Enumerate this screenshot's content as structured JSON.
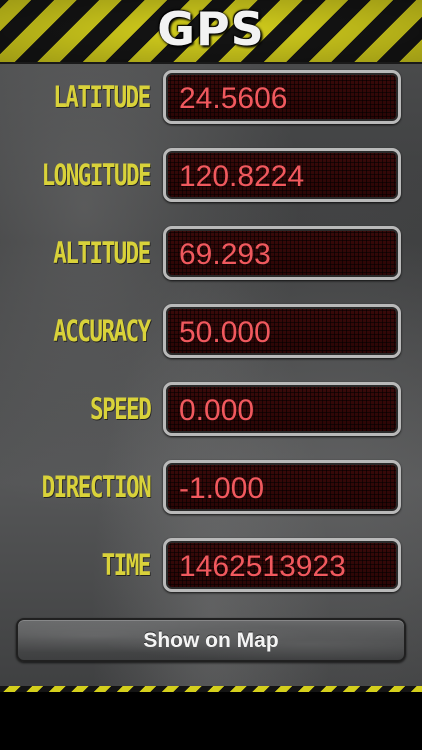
{
  "app": {
    "title": "GPS"
  },
  "fields": [
    {
      "label": "LATITUDE",
      "value": "24.5606"
    },
    {
      "label": "LONGITUDE",
      "value": "120.8224"
    },
    {
      "label": "ALTITUDE",
      "value": "69.293"
    },
    {
      "label": "ACCURACY",
      "value": "50.000"
    },
    {
      "label": "SPEED",
      "value": "0.000"
    },
    {
      "label": "DIRECTION",
      "value": "-1.000"
    },
    {
      "label": "TIME",
      "value": "1462513923"
    }
  ],
  "map_button": {
    "label": "Show on Map"
  },
  "colors": {
    "label_yellow": "#d9d23a",
    "value_red": "#f0595e",
    "hazard_yellow": "#d4cf1c"
  }
}
